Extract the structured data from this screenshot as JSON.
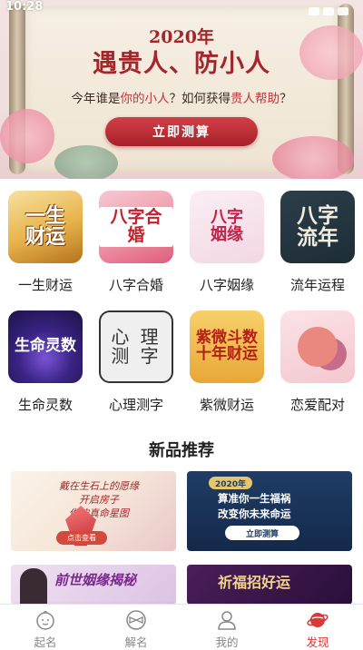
{
  "status_bar": {
    "time": "10:28"
  },
  "banner": {
    "year": "2020年",
    "title": "遇贵人、防小人",
    "question_parts": [
      "今年谁是",
      "你的小人",
      "？如何获得",
      "贵人帮助",
      "？"
    ],
    "button_label": "立即测算",
    "pages": 6,
    "active_page": 1
  },
  "grid": {
    "items": [
      {
        "label": "一生财运",
        "tile_text": "一生\n财运",
        "icon": "fortune-life-icon"
      },
      {
        "label": "八字合婚",
        "tile_text": "八字合婚",
        "icon": "bazi-marriage-icon"
      },
      {
        "label": "八字姻缘",
        "tile_text": "八字\n姻缘",
        "icon": "bazi-romance-icon"
      },
      {
        "label": "流年运程",
        "tile_text": "八字\n流年",
        "icon": "yearly-luck-icon"
      },
      {
        "label": "生命灵数",
        "tile_text": "生命灵数",
        "icon": "life-number-icon"
      },
      {
        "label": "心理测字",
        "tile_text": "心 理\n测 字",
        "icon": "psych-character-icon"
      },
      {
        "label": "紫微财运",
        "tile_text": "紫微斗数\n十年财运",
        "icon": "ziwei-wealth-icon"
      },
      {
        "label": "恋爱配对",
        "tile_text": "",
        "icon": "love-match-icon"
      }
    ]
  },
  "new_products": {
    "title": "新品推荐",
    "cards": [
      {
        "text": "戴在生石上的愿缘\n开启房子\n你的真命星图",
        "button": "点击查看"
      },
      {
        "year": "2020年",
        "text": "算准你一生福祸\n改变你未来命运",
        "button": "立即测算"
      },
      {
        "text": "前世姻缘揭秘"
      },
      {
        "text": "祈福招好运"
      }
    ]
  },
  "tabbar": {
    "tabs": [
      {
        "label": "起名",
        "icon": "baby-face-icon"
      },
      {
        "label": "解名",
        "icon": "bowtie-icon"
      },
      {
        "label": "我的",
        "icon": "person-icon"
      },
      {
        "label": "发现",
        "icon": "planet-icon"
      }
    ],
    "active": "发现",
    "active_color": "#d83a3a"
  },
  "colors": {
    "accent": "#a3262c",
    "button": "#c32f37"
  }
}
